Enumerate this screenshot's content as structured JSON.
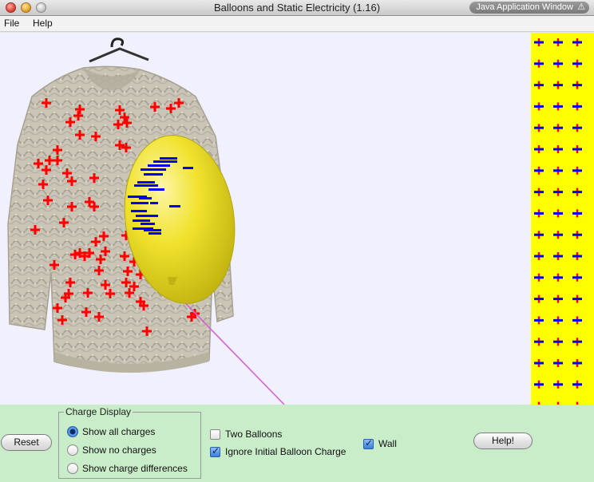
{
  "window": {
    "title": "Balloons and Static Electricity (1.16)",
    "badge": "Java Application Window"
  },
  "menu": {
    "file": "File",
    "help": "Help"
  },
  "controls": {
    "reset_label": "Reset",
    "charge_display": {
      "legend": "Charge Display",
      "options": [
        {
          "label": "Show all charges",
          "selected": true
        },
        {
          "label": "Show no charges",
          "selected": false
        },
        {
          "label": "Show charge differences",
          "selected": false
        }
      ]
    },
    "two_balloons": {
      "label": "Two Balloons",
      "checked": false
    },
    "ignore_initial": {
      "label": "Ignore Initial Balloon Charge",
      "checked": true
    },
    "wall": {
      "label": "Wall",
      "checked": true
    },
    "help_label": "Help!"
  },
  "colors": {
    "play_bg": "#f0f0fe",
    "panel_bg": "#c9ecc9",
    "wall": "#ffff00",
    "positive": "#ff0000",
    "negative": "#0000ff",
    "balloon": "#f2e52a",
    "string": "#d563d5"
  }
}
